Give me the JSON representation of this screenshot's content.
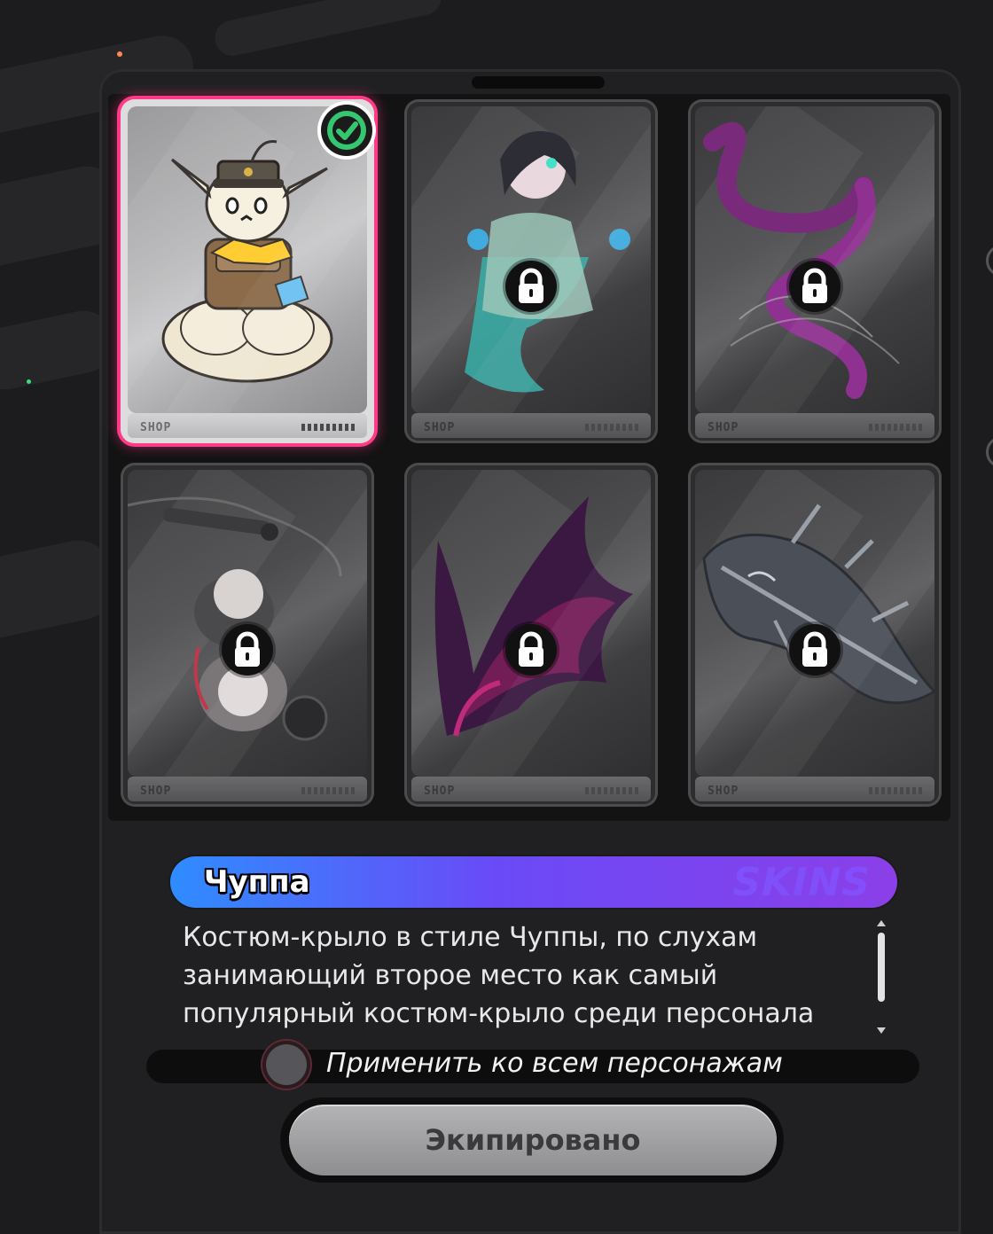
{
  "cards": [
    {
      "name": "chuppa-wing",
      "selected": true,
      "locked": false,
      "footer_label": "SHOP"
    },
    {
      "name": "ghost-costume",
      "selected": false,
      "locked": true,
      "footer_label": "SHOP"
    },
    {
      "name": "ribbon-wing",
      "selected": false,
      "locked": true,
      "footer_label": "SHOP"
    },
    {
      "name": "scythe-doll",
      "selected": false,
      "locked": true,
      "footer_label": "SHOP"
    },
    {
      "name": "purple-flame-wing",
      "selected": false,
      "locked": true,
      "footer_label": "SHOP"
    },
    {
      "name": "mechanical-wing",
      "selected": false,
      "locked": true,
      "footer_label": "SHOP"
    }
  ],
  "selected_item": {
    "name": "Чуппа",
    "category_watermark": "SKINS",
    "description": "Костюм-крыло в стиле Чуппы, по слухам занимающий второе место как самый популярный костюм-крыло среди персонала"
  },
  "apply_all": {
    "label": "Применить ко всем персонажам",
    "checked": false
  },
  "equip_button": {
    "label": "Экипировано"
  },
  "colors": {
    "selection": "#ff3a86",
    "name_bar_start": "#2f8cff",
    "name_bar_end": "#8b3fe8",
    "check": "#34c76f"
  },
  "icons": [
    "lock-icon",
    "check-icon",
    "scroll-arrow-up-icon",
    "scroll-arrow-down-icon"
  ]
}
